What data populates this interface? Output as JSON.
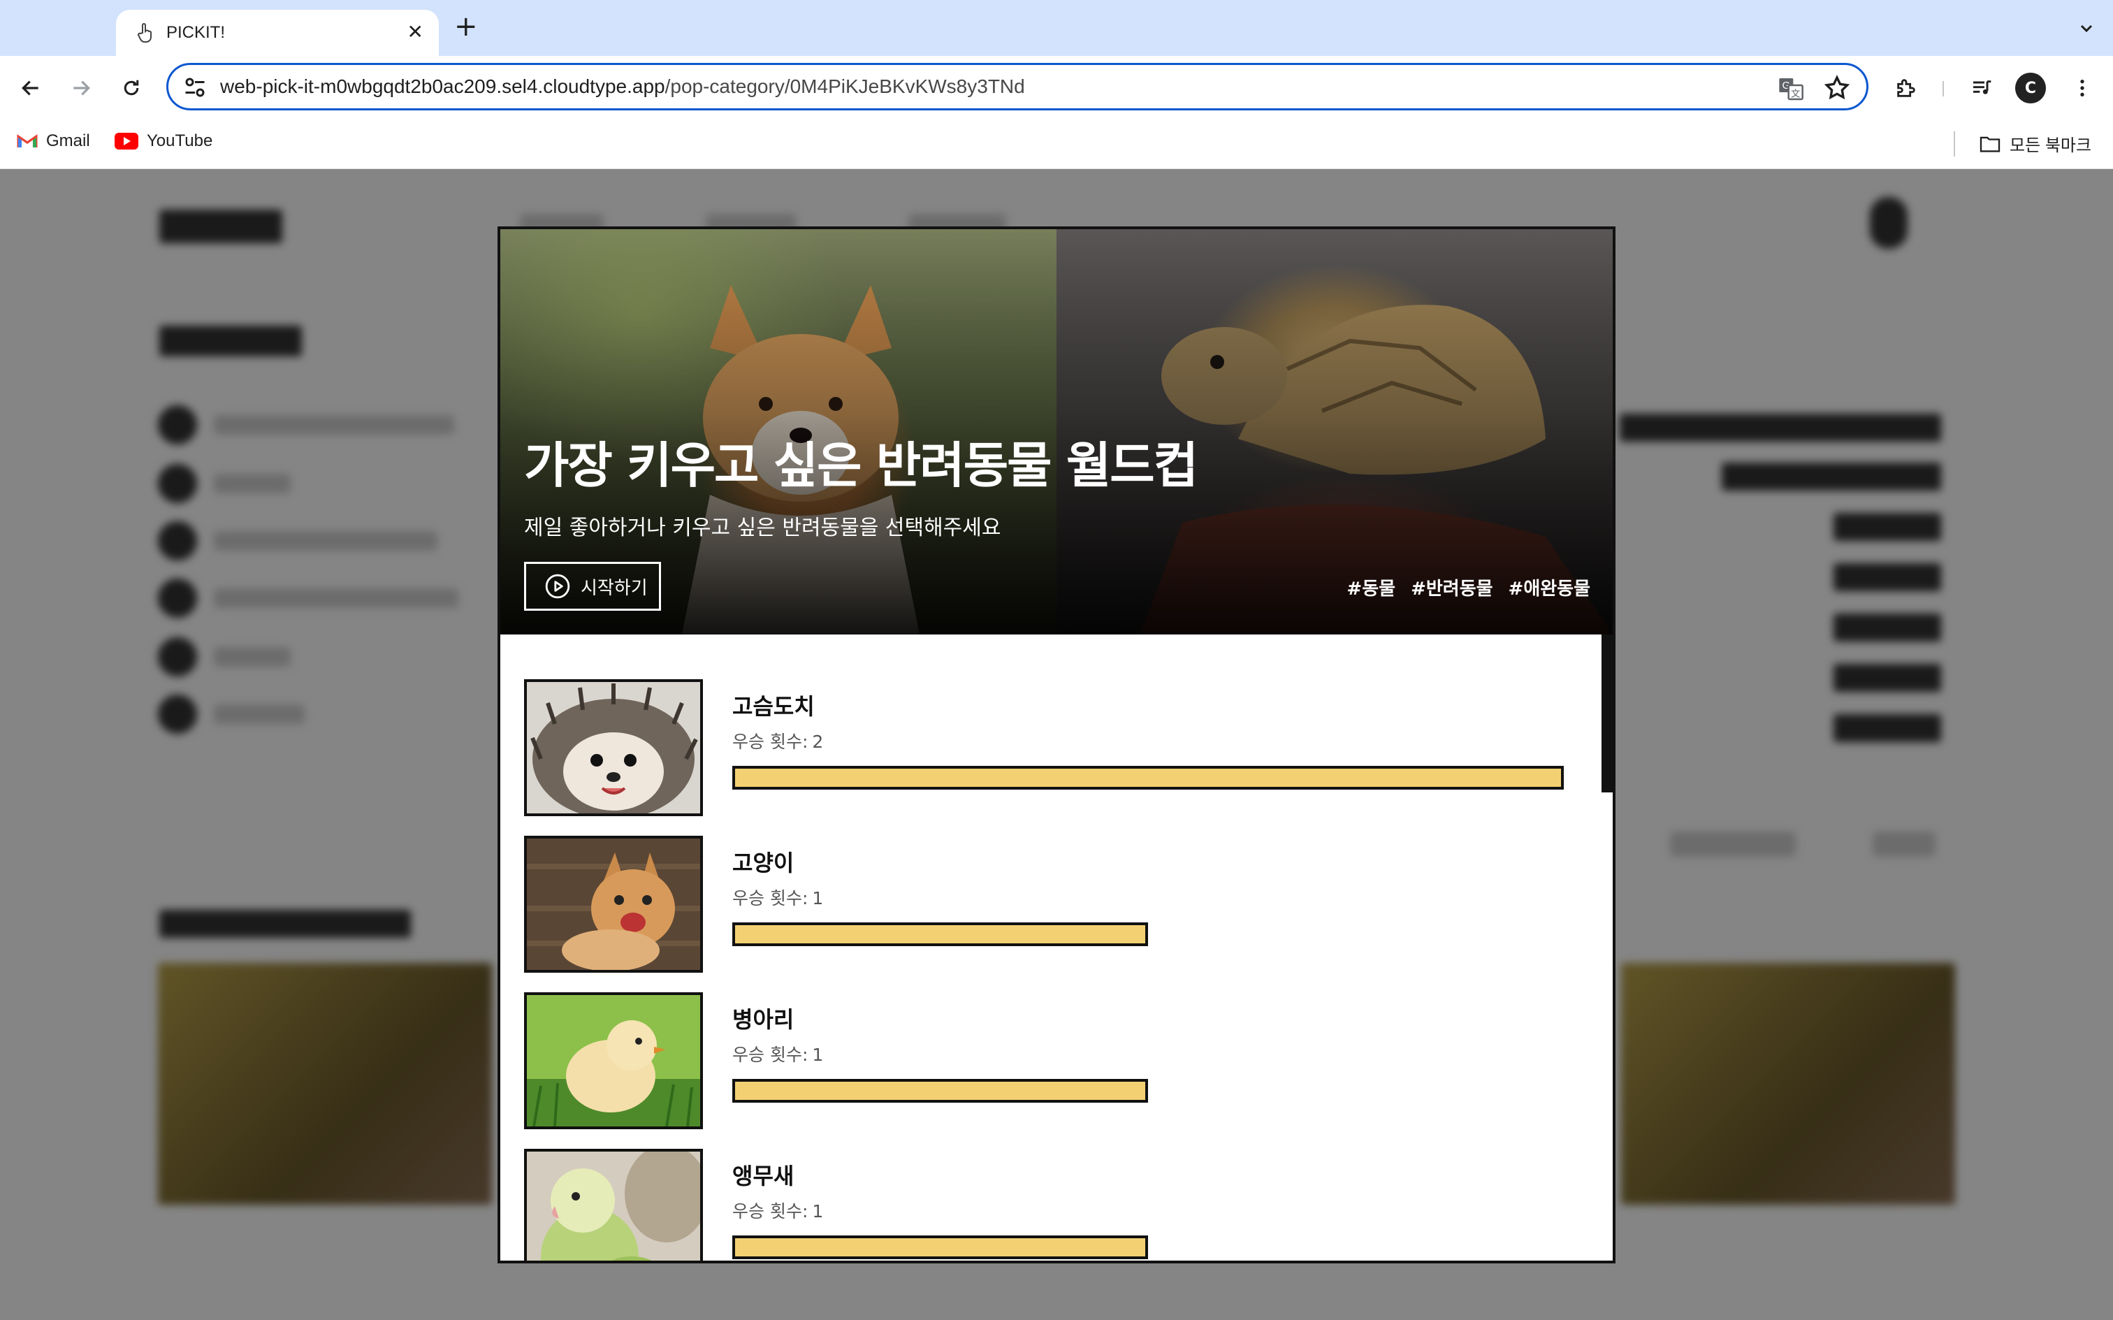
{
  "browser": {
    "tab": {
      "title": "PICKIT!",
      "favicon": "hand-pointer-icon"
    },
    "url": {
      "host": "web-pick-it-m0wbgqdt2b0ac209.sel4.cloudtype.app",
      "path": "/pop-category/0M4PiKJeBKvKWs8y3TNd"
    },
    "bookmarks": [
      {
        "label": "Gmail",
        "icon": "gmail-icon"
      },
      {
        "label": "YouTube",
        "icon": "youtube-icon"
      }
    ],
    "all_bookmarks_label": "모든 북마크",
    "profile_initial": "C"
  },
  "modal": {
    "title": "가장 키우고 싶은 반려동물 월드컵",
    "subtitle": "제일 좋아하거나 키우고 싶은 반려동물을 선택해주세요",
    "start_label": "시작하기",
    "tags": [
      "#동물",
      "#반려동물",
      "#애완동물"
    ],
    "count_label": "우승 횟수:",
    "ranking": [
      {
        "name": "고슴도치",
        "wins": 2,
        "ratio": 1.0
      },
      {
        "name": "고양이",
        "wins": 1,
        "ratio": 0.5
      },
      {
        "name": "병아리",
        "wins": 1,
        "ratio": 0.5
      },
      {
        "name": "앵무새",
        "wins": 1,
        "ratio": 0.5
      }
    ]
  },
  "colors": {
    "bar_fill": "#f3d172",
    "border": "#111111",
    "omnibox_focus": "#0b57d0",
    "tabstrip": "#d3e3fd"
  }
}
